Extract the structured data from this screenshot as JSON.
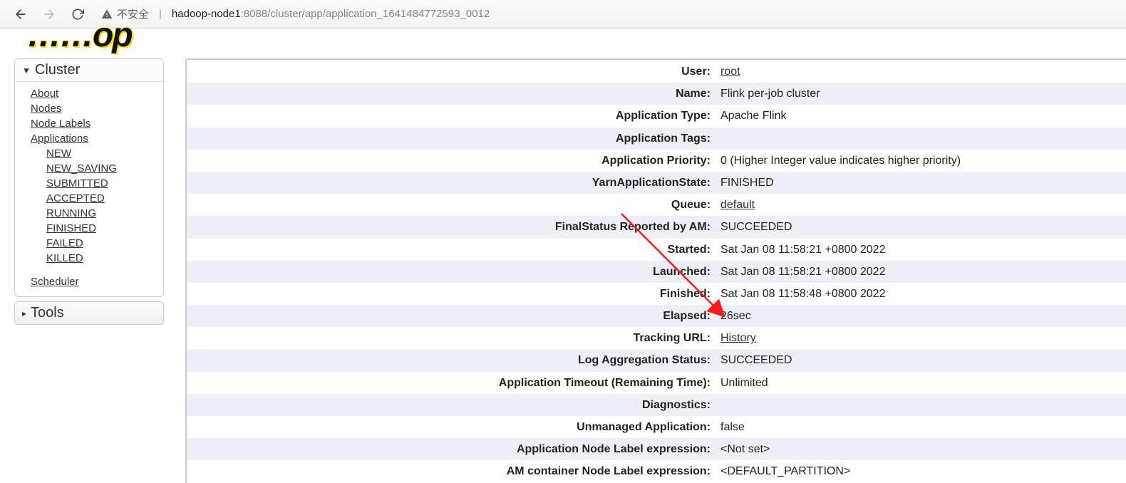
{
  "browser": {
    "insecure_label": "不安全",
    "url_host": "hadoop-node1",
    "url_path": ":8088/cluster/app/application_1641484772593_0012"
  },
  "logo_fragment": "……op",
  "sidebar": {
    "cluster_label": "Cluster",
    "links": {
      "about": "About",
      "nodes": "Nodes",
      "node_labels": "Node Labels",
      "applications": "Applications",
      "new": "NEW",
      "new_saving": "NEW_SAVING",
      "submitted": "SUBMITTED",
      "accepted": "ACCEPTED",
      "running": "RUNNING",
      "finished": "FINISHED",
      "failed": "FAILED",
      "killed": "KILLED",
      "scheduler": "Scheduler"
    },
    "tools_label": "Tools"
  },
  "details": {
    "user_k": "User:",
    "user_v": "root",
    "name_k": "Name:",
    "name_v": "Flink per-job cluster",
    "apptype_k": "Application Type:",
    "apptype_v": "Apache Flink",
    "apptags_k": "Application Tags:",
    "apptags_v": "",
    "apppri_k": "Application Priority:",
    "apppri_v": "0 (Higher Integer value indicates higher priority)",
    "yarnstate_k": "YarnApplicationState:",
    "yarnstate_v": "FINISHED",
    "queue_k": "Queue:",
    "queue_v": "default",
    "finalstatus_k": "FinalStatus Reported by AM:",
    "finalstatus_v": "SUCCEEDED",
    "started_k": "Started:",
    "started_v": "Sat Jan 08 11:58:21 +0800 2022",
    "launched_k": "Launched:",
    "launched_v": "Sat Jan 08 11:58:21 +0800 2022",
    "finished_k": "Finished:",
    "finished_v": "Sat Jan 08 11:58:48 +0800 2022",
    "elapsed_k": "Elapsed:",
    "elapsed_v": "26sec",
    "tracking_k": "Tracking URL:",
    "tracking_v": "History",
    "logagg_k": "Log Aggregation Status:",
    "logagg_v": "SUCCEEDED",
    "timeout_k": "Application Timeout (Remaining Time):",
    "timeout_v": "Unlimited",
    "diag_k": "Diagnostics:",
    "diag_v": "",
    "unmanaged_k": "Unmanaged Application:",
    "unmanaged_v": "false",
    "appnodelabel_k": "Application Node Label expression:",
    "appnodelabel_v": "<Not set>",
    "amnodelabel_k": "AM container Node Label expression:",
    "amnodelabel_v": "<DEFAULT_PARTITION>"
  }
}
